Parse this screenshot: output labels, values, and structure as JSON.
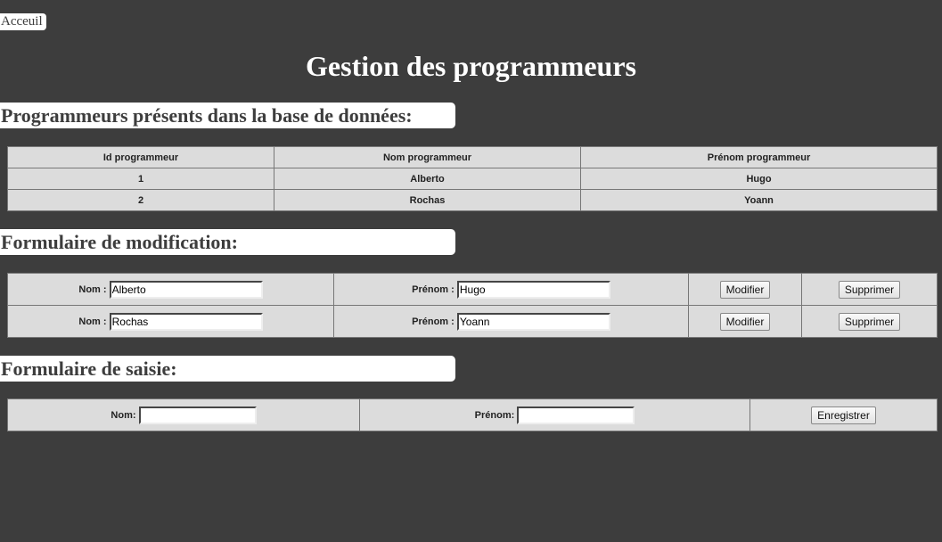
{
  "nav": {
    "home_label": "Acceuil"
  },
  "page_title": "Gestion des programmeurs",
  "list_section": {
    "heading": "Programmeurs présents dans la base de données:",
    "columns": [
      "Id programmeur",
      "Nom programmeur",
      "Prénom programmeur"
    ],
    "rows": [
      [
        "1",
        "Alberto",
        "Hugo"
      ],
      [
        "2",
        "Rochas",
        "Yoann"
      ]
    ]
  },
  "edit_section": {
    "heading": "Formulaire de modification:",
    "nom_label": "Nom :",
    "prenom_label": "Prénom :",
    "modify_label": "Modifier",
    "delete_label": "Supprimer",
    "rows": [
      {
        "nom": "Alberto",
        "prenom": "Hugo"
      },
      {
        "nom": "Rochas",
        "prenom": "Yoann"
      }
    ]
  },
  "create_section": {
    "heading": "Formulaire de saisie:",
    "nom_label": "Nom:",
    "prenom_label": "Prénom:",
    "nom_value": "",
    "prenom_value": "",
    "save_label": "Enregistrer"
  }
}
